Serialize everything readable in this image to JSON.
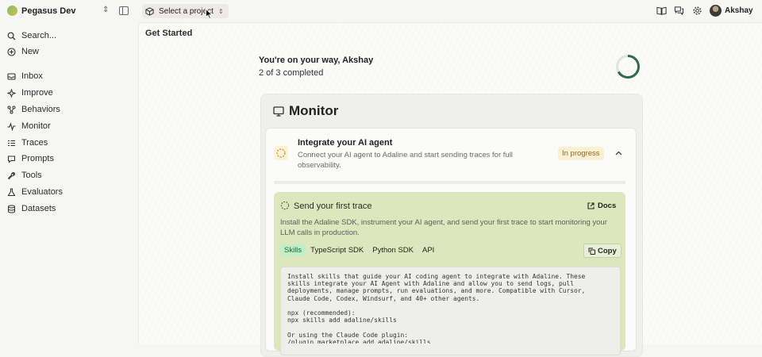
{
  "workspace": {
    "name": "Pegasus Dev"
  },
  "project_selector": {
    "label": "Select a project"
  },
  "user": {
    "name": "Akshay"
  },
  "search": {
    "label": "Search..."
  },
  "sidebar": {
    "new_label": "New",
    "items": [
      {
        "label": "Inbox",
        "icon": "inbox-icon"
      },
      {
        "label": "Improve",
        "icon": "sparkle-icon"
      },
      {
        "label": "Behaviors",
        "icon": "nodes-icon"
      },
      {
        "label": "Monitor",
        "icon": "pulse-icon"
      },
      {
        "label": "Traces",
        "icon": "list-icon"
      },
      {
        "label": "Prompts",
        "icon": "prompt-icon"
      },
      {
        "label": "Tools",
        "icon": "wrench-icon"
      },
      {
        "label": "Evaluators",
        "icon": "flask-icon"
      },
      {
        "label": "Datasets",
        "icon": "database-icon"
      }
    ]
  },
  "page": {
    "title": "Get Started"
  },
  "onboarding": {
    "welcome": "You're on your way, Akshay",
    "progress_text": "2 of 3 completed",
    "progress_fraction": 0.667,
    "section_title": "Monitor",
    "task": {
      "title": "Integrate your AI agent",
      "description": "Connect your AI agent to Adaline and start sending traces for full observability.",
      "status": "In progress"
    },
    "step": {
      "title": "Send your first trace",
      "docs_label": "Docs",
      "description": "Install the Adaline SDK, instrument your AI agent, and send your first trace to start monitoring your LLM calls in production.",
      "tabs": [
        "Skills",
        "TypeScript SDK",
        "Python SDK",
        "API"
      ],
      "active_tab": "Skills",
      "copy_label": "Copy",
      "code": "Install skills that guide your AI coding agent to integrate with Adaline. These\nskills integrate your AI Agent with Adaline and allow you to send logs, pull\ndeployments, manage prompts, run evaluations, and more. Compatible with Cursor,\nClaude Code, Codex, Windsurf, and 40+ other agents.\n\nnpx (recommended):\nnpx skills add adaline/skills\n\nOr using the Claude Code plugin:\n/plugin marketplace add adaline/skills"
    }
  },
  "colors": {
    "accent": "#2e6b46",
    "step_bg": "#dce7bd",
    "badge_bg": "#fbf0d3",
    "active_tab": "#bfeec9"
  }
}
